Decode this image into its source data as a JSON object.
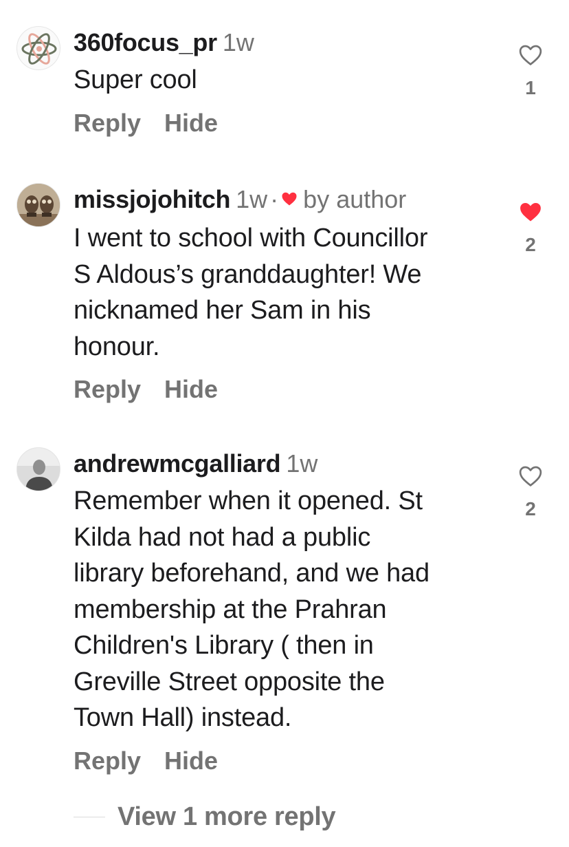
{
  "comments": [
    {
      "username": "360focus_pr",
      "time": "1w",
      "text_lines": [
        "Super cool"
      ],
      "reply_label": "Reply",
      "hide_label": "Hide",
      "like_count": "1",
      "liked": false,
      "by_author": false
    },
    {
      "username": "missjojohitch",
      "time": "1w",
      "separator": "·",
      "by_author_label": "by author",
      "text_lines": [
        "I went to school with Councillor",
        "S Aldous’s granddaughter! We",
        "nicknamed her Sam in his",
        "honour."
      ],
      "reply_label": "Reply",
      "hide_label": "Hide",
      "like_count": "2",
      "liked": true,
      "by_author": true
    },
    {
      "username": "andrewmcgalliard",
      "time": "1w",
      "text_lines": [
        "Remember when it opened. St",
        "Kilda had not had a public",
        "library beforehand, and we had",
        "membership at the Prahran",
        "Children's Library ( then in",
        "Greville Street opposite the",
        "Town Hall) instead."
      ],
      "reply_label": "Reply",
      "hide_label": "Hide",
      "like_count": "2",
      "liked": false,
      "by_author": false
    }
  ],
  "view_more_label": "View 1 more reply",
  "colors": {
    "like_red": "#ff3040",
    "secondary_text": "#737373",
    "primary_text": "#1c1c1e"
  }
}
